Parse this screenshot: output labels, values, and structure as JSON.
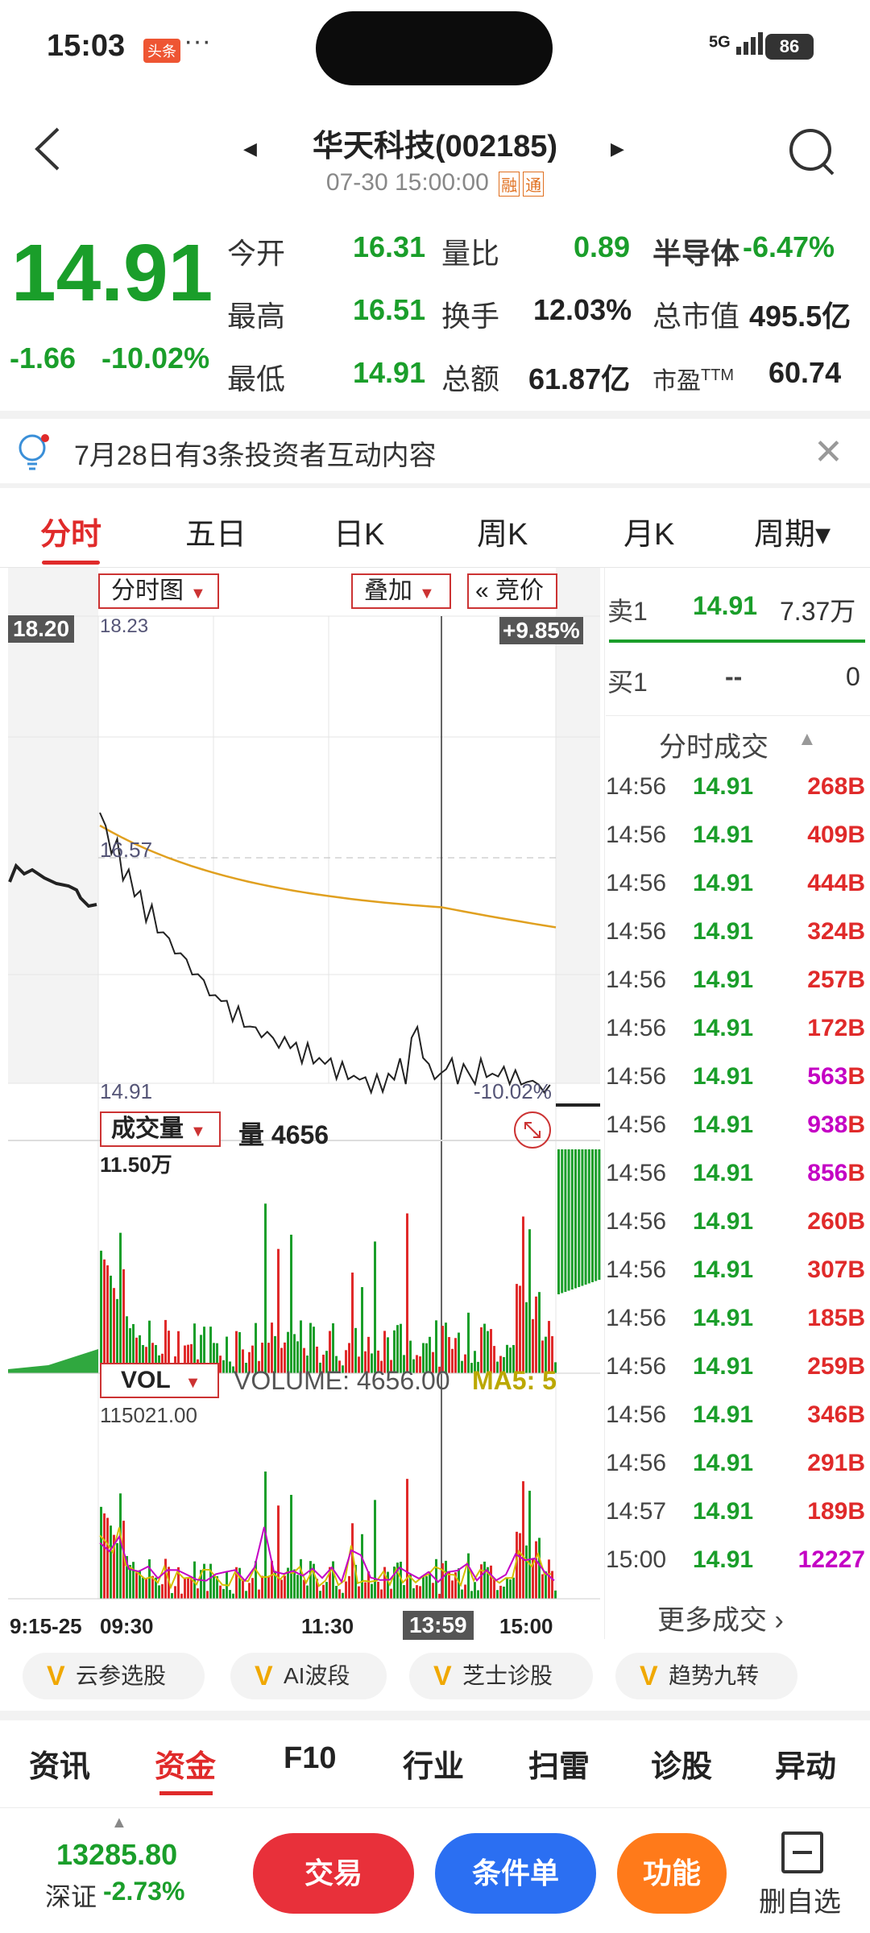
{
  "status_bar": {
    "time": "15:03",
    "toutiao": "头条",
    "dots": "···",
    "signal": "5G",
    "battery": "86"
  },
  "header": {
    "title": "华天科技(002185)",
    "datetime": "07-30 15:00:00",
    "tag1": "融",
    "tag2": "通"
  },
  "quote": {
    "price": "14.91",
    "change": "-1.66",
    "change_pct": "-10.02%",
    "rows": [
      {
        "l1": "今开",
        "v1": "16.31",
        "l2": "量比",
        "v2": "0.89",
        "l3": "半导体",
        "v3": "-6.47%"
      },
      {
        "l1": "最高",
        "v1": "16.51",
        "l2": "换手",
        "v2": "12.03%",
        "l3": "总市值",
        "v3": "495.5亿"
      },
      {
        "l1": "最低",
        "v1": "14.91",
        "l2": "总额",
        "v2": "61.87亿",
        "l3": "市盈",
        "l3sup": "TTM",
        "v3": "60.74"
      }
    ]
  },
  "notice": {
    "text": "7月28日有3条投资者互动内容",
    "close": "✕"
  },
  "chart_tabs": [
    "分时",
    "五日",
    "日K",
    "周K",
    "月K",
    "周期▾"
  ],
  "chart_ui": {
    "type_btn": "分时图",
    "overlay_btn": "叠加",
    "auction_btn": "« 竞价",
    "top_left_price": "18.20",
    "top_price": "18.23",
    "top_pct": "+9.85%",
    "mid_price": "16.57",
    "low_price": "14.91",
    "low_pct": "-10.02%",
    "vol_btn": "成交量",
    "vol_label": "量",
    "vol_value": "4656",
    "vol_max": "11.50万",
    "ind_btn": "VOL",
    "ind_label": "VOLUME: 4656.00",
    "ma5": "MA5: 5",
    "ind_max": "115021.00",
    "x_labels": [
      "9:15-25",
      "09:30",
      "11:30",
      "13:59",
      "15:00"
    ]
  },
  "order_book": {
    "sell_label": "卖1",
    "sell_price": "14.91",
    "sell_vol": "7.37万",
    "buy_label": "买1",
    "buy_price": "--",
    "buy_vol": "0",
    "trades_title": "分时成交",
    "trades": [
      {
        "t": "14:56",
        "p": "14.91",
        "v": "268",
        "s": "B",
        "c": "red"
      },
      {
        "t": "14:56",
        "p": "14.91",
        "v": "409",
        "s": "B",
        "c": "red"
      },
      {
        "t": "14:56",
        "p": "14.91",
        "v": "444",
        "s": "B",
        "c": "red"
      },
      {
        "t": "14:56",
        "p": "14.91",
        "v": "324",
        "s": "B",
        "c": "red"
      },
      {
        "t": "14:56",
        "p": "14.91",
        "v": "257",
        "s": "B",
        "c": "red"
      },
      {
        "t": "14:56",
        "p": "14.91",
        "v": "172",
        "s": "B",
        "c": "red"
      },
      {
        "t": "14:56",
        "p": "14.91",
        "v": "563",
        "s": "B",
        "c": "magenta"
      },
      {
        "t": "14:56",
        "p": "14.91",
        "v": "938",
        "s": "B",
        "c": "magenta"
      },
      {
        "t": "14:56",
        "p": "14.91",
        "v": "856",
        "s": "B",
        "c": "magenta"
      },
      {
        "t": "14:56",
        "p": "14.91",
        "v": "260",
        "s": "B",
        "c": "red"
      },
      {
        "t": "14:56",
        "p": "14.91",
        "v": "307",
        "s": "B",
        "c": "red"
      },
      {
        "t": "14:56",
        "p": "14.91",
        "v": "185",
        "s": "B",
        "c": "red"
      },
      {
        "t": "14:56",
        "p": "14.91",
        "v": "259",
        "s": "B",
        "c": "red"
      },
      {
        "t": "14:56",
        "p": "14.91",
        "v": "346",
        "s": "B",
        "c": "red"
      },
      {
        "t": "14:56",
        "p": "14.91",
        "v": "291",
        "s": "B",
        "c": "red"
      },
      {
        "t": "14:57",
        "p": "14.91",
        "v": "189",
        "s": "B",
        "c": "red"
      },
      {
        "t": "15:00",
        "p": "14.91",
        "v": "12227",
        "s": "",
        "c": "magenta"
      }
    ],
    "more": "更多成交 ›"
  },
  "feature_chips": [
    "云参选股",
    "AI波段",
    "芝士诊股",
    "趋势九转"
  ],
  "bottom_tabs": [
    "资讯",
    "资金",
    "F10",
    "行业",
    "扫雷",
    "诊股",
    "异动"
  ],
  "footer": {
    "index_value": "13285.80",
    "index_name": "深证",
    "index_pct": "-2.73%",
    "trade_btn": "交易",
    "cond_btn": "条件单",
    "func_btn": "功能",
    "remove_label": "删自选"
  },
  "colors": {
    "up": "#e02a2a",
    "down": "#1a9e2a",
    "avg_line": "#e0a020",
    "magenta": "#c400c4",
    "accent": "#e02a2a"
  }
}
